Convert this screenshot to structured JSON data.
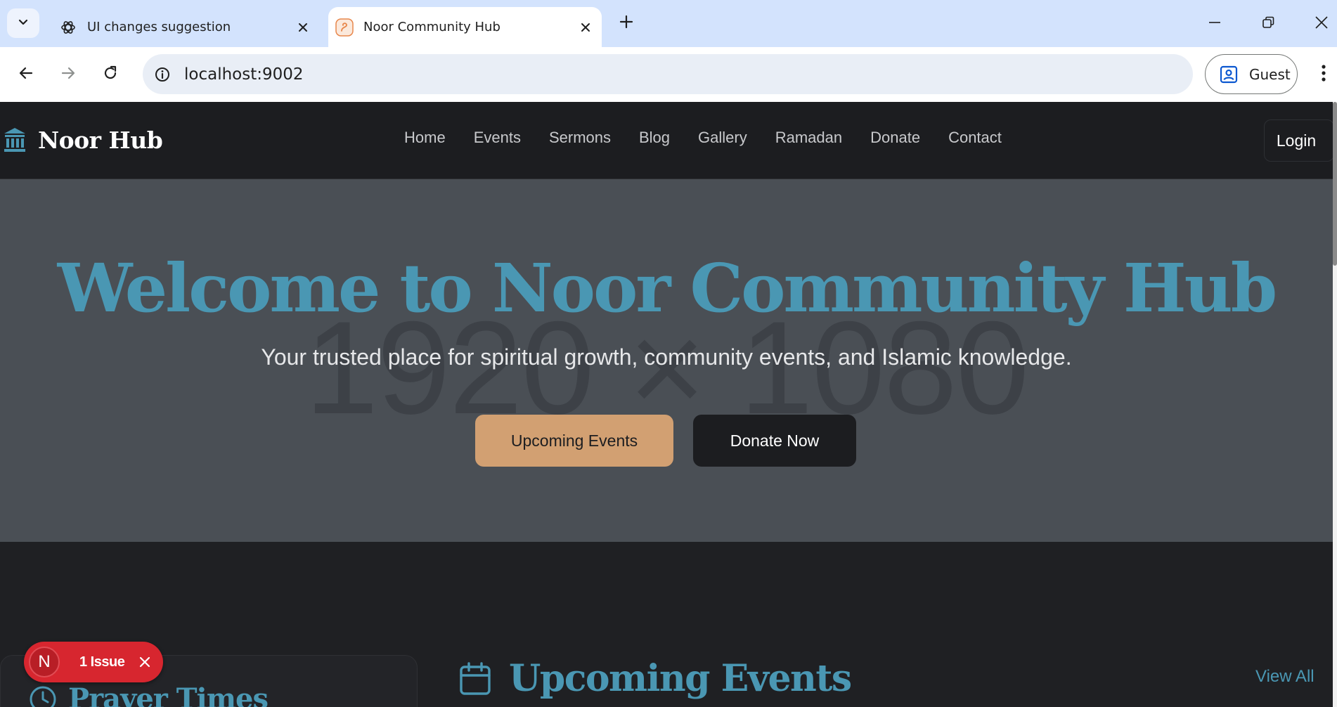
{
  "browser": {
    "tabs": [
      {
        "title": "UI changes suggestion",
        "icon": "openai-icon",
        "active": false
      },
      {
        "title": "Noor Community Hub",
        "icon": "site-favicon",
        "active": true
      }
    ],
    "url": "localhost:9002",
    "profile_label": "Guest"
  },
  "site": {
    "brand": "Noor Hub",
    "nav": [
      "Home",
      "Events",
      "Sermons",
      "Blog",
      "Gallery",
      "Ramadan",
      "Donate",
      "Contact"
    ],
    "login_label": "Login"
  },
  "hero": {
    "placeholder_text": "1920 × 1080",
    "title": "Welcome to Noor Community Hub",
    "subtitle": "Your trusted place for spiritual growth, community events, and Islamic knowledge.",
    "primary_button": "Upcoming Events",
    "secondary_button": "Donate Now"
  },
  "sections": {
    "prayer_times_title": "Prayer Times",
    "upcoming_events_title": "Upcoming Events",
    "view_all_label": "View All"
  },
  "dev_overlay": {
    "avatar_letter": "N",
    "issue_label": "1 Issue"
  },
  "colors": {
    "accent": "#4a97b3",
    "primary_button": "#d2a072",
    "hero_bg": "#4a4f55",
    "page_bg": "#1f2023",
    "issue_badge": "#d7262f"
  }
}
